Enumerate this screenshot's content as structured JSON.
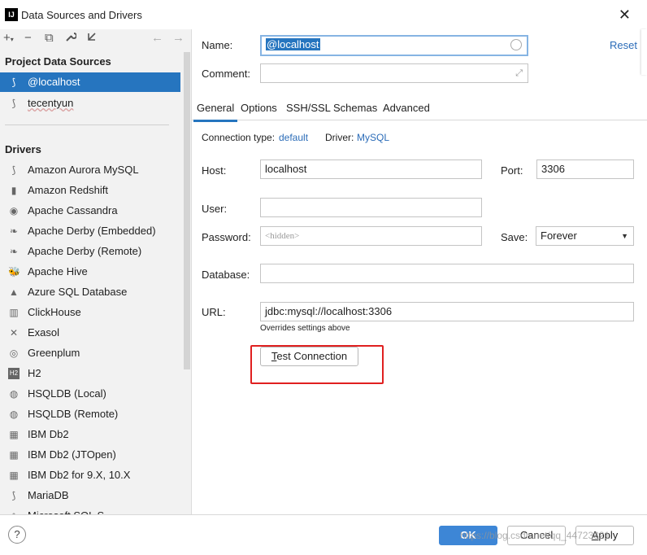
{
  "window": {
    "title": "Data Sources and Drivers",
    "app_icon": "IJ"
  },
  "toolbar": {
    "add": "+",
    "add_caret": "▾",
    "remove": "−",
    "copy": "⧉",
    "wrench": "🔧",
    "import": "⤓",
    "back": "←",
    "forward": "→"
  },
  "sidebar": {
    "project_title": "Project Data Sources",
    "project_items": [
      {
        "label": "@localhost",
        "icon": "mysql-icon"
      },
      {
        "label": "tecentyun",
        "icon": "mysql-icon"
      }
    ],
    "drivers_title": "Drivers",
    "drivers": [
      {
        "label": "Amazon Aurora MySQL",
        "glyph": "⟆"
      },
      {
        "label": "Amazon Redshift",
        "glyph": "▮"
      },
      {
        "label": "Apache Cassandra",
        "glyph": "◉"
      },
      {
        "label": "Apache Derby (Embedded)",
        "glyph": "❧"
      },
      {
        "label": "Apache Derby (Remote)",
        "glyph": "❧"
      },
      {
        "label": "Apache Hive",
        "glyph": "🐝"
      },
      {
        "label": "Azure SQL Database",
        "glyph": "▲"
      },
      {
        "label": "ClickHouse",
        "glyph": "▥"
      },
      {
        "label": "Exasol",
        "glyph": "✕"
      },
      {
        "label": "Greenplum",
        "glyph": "◎"
      },
      {
        "label": "H2",
        "glyph": "H2"
      },
      {
        "label": "HSQLDB (Local)",
        "glyph": "◍"
      },
      {
        "label": "HSQLDB (Remote)",
        "glyph": "◍"
      },
      {
        "label": "IBM Db2",
        "glyph": "▦"
      },
      {
        "label": "IBM Db2 (JTOpen)",
        "glyph": "▦"
      },
      {
        "label": "IBM Db2 for 9.X, 10.X",
        "glyph": "▦"
      },
      {
        "label": "MariaDB",
        "glyph": "⟆"
      },
      {
        "label": "Microsoft SQL S",
        "glyph": "◈"
      }
    ]
  },
  "form": {
    "name_label": "Name:",
    "name_value": "@localhost",
    "reset": "Reset",
    "comment_label": "Comment:",
    "comment_value": "",
    "expand_icon": "⤢",
    "tabs": [
      "General",
      "Options",
      "SSH/SSL",
      "Schemas",
      "Advanced"
    ],
    "conn_type_label": "Connection type:",
    "conn_type_value": "default",
    "driver_label": "Driver:",
    "driver_value": "MySQL",
    "host_label": "Host:",
    "host_value": "localhost",
    "port_label": "Port:",
    "port_value": "3306",
    "user_label": "User:",
    "user_value": "",
    "password_label": "Password:",
    "password_placeholder": "<hidden>",
    "save_label": "Save:",
    "save_value": "Forever",
    "database_label": "Database:",
    "database_value": "",
    "url_label": "URL:",
    "url_value": "jdbc:mysql://localhost:3306",
    "url_hint": "Overrides settings above",
    "test_first_char": "T",
    "test_rest": "est Connection"
  },
  "footer": {
    "help": "?",
    "ok": "OK",
    "cancel": "Cancel",
    "apply_first_char": "A",
    "apply_rest": "pply",
    "watermark": "https://blog.csdn.net/qq_44723321"
  },
  "colors": {
    "selection": "#2675bf",
    "link": "#2b6cb8",
    "highlight_box": "#e02020"
  }
}
